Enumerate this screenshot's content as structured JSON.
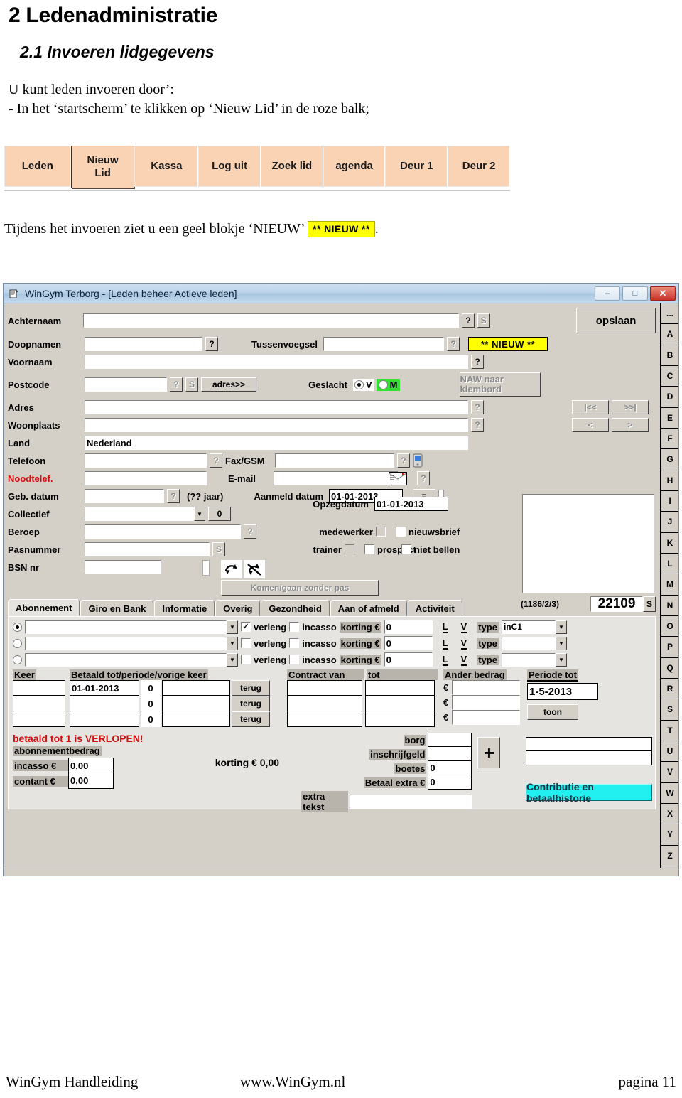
{
  "document": {
    "heading1": "2 Ledenadministratie",
    "heading2": "2.1 Invoeren lidgegevens",
    "para_line1": "U kunt leden invoeren door’:",
    "para_line2": "- In het ‘startscherm’ te klikken op ‘Nieuw Lid’ in de roze balk;",
    "caption_before": "Tijdens het invoeren ziet u een geel blokje ‘NIEUW’",
    "caption_badge": "** NIEUW **",
    "caption_after": "."
  },
  "pink_toolbar": {
    "buttons": [
      {
        "label": "Leden",
        "active": false
      },
      {
        "label": "Nieuw Lid",
        "active": true
      },
      {
        "label": "Kassa",
        "active": false
      },
      {
        "label": "Log uit",
        "active": false
      },
      {
        "label": "Zoek lid",
        "active": false
      },
      {
        "label": "agenda",
        "active": false
      },
      {
        "label": "Deur 1",
        "active": false
      },
      {
        "label": "Deur 2",
        "active": false
      }
    ],
    "accent_color": "#fad2b4"
  },
  "app_window": {
    "title": "WinGym Terborg - [Leden beheer Actieve leden]",
    "icon": "app-icon",
    "window_buttons": [
      {
        "name": "minimize",
        "glyph": "–"
      },
      {
        "name": "restore",
        "glyph": "□"
      },
      {
        "name": "close",
        "glyph": "✕"
      }
    ],
    "form": {
      "achternaam": {
        "label": "Achternaam",
        "value": ""
      },
      "doopnamen": {
        "label": "Doopnamen",
        "value": ""
      },
      "tussenvoegsel": {
        "label": "Tussenvoegsel",
        "value": ""
      },
      "voornaam": {
        "label": "Voornaam",
        "value": ""
      },
      "postcode": {
        "label": "Postcode",
        "value": ""
      },
      "adres_button": "adres>>",
      "geslacht": {
        "label": "Geslacht",
        "option_v": "V",
        "option_m": "M",
        "selected": "V"
      },
      "adres": {
        "label": "Adres",
        "value": ""
      },
      "woonplaats": {
        "label": "Woonplaats",
        "value": ""
      },
      "land": {
        "label": "Land",
        "value": "Nederland"
      },
      "telefoon": {
        "label": "Telefoon",
        "value": ""
      },
      "faxgsm": {
        "label": "Fax/GSM",
        "value": ""
      },
      "noodtelef": {
        "label": "Noodtelef.",
        "value": ""
      },
      "email": {
        "label": "E-mail",
        "value": ""
      },
      "geb_datum": {
        "label": "Geb. datum",
        "value": "",
        "age_hint": "(?? jaar)"
      },
      "collectief": {
        "label": "Collectief",
        "value": "",
        "side_button": "0"
      },
      "beroep": {
        "label": "Beroep",
        "value": ""
      },
      "pasnummer": {
        "label": "Pasnummer",
        "value": ""
      },
      "bsn_nr": {
        "label": "BSN nr",
        "value": ""
      },
      "aanmeld_datum": {
        "label": "Aanmeld datum",
        "value": "01-01-2013"
      },
      "opzegdatum": {
        "label": "Opzegdatum",
        "value": "01-01-2013"
      },
      "equals_button": "=",
      "medewerker": {
        "label": "medewerker",
        "checked": false
      },
      "trainer": {
        "label": "trainer",
        "checked": false
      },
      "nieuwsbrief": {
        "label": "nieuwsbrief",
        "checked": false
      },
      "prospect": {
        "label": "prospect",
        "checked": false
      },
      "niet_bellen": {
        "label": "niet bellen",
        "checked": false
      },
      "komen_gaan_button": "Komen/gaan zonder pas",
      "new_badge": "** NIEUW **",
      "opslaan_button": "opslaan",
      "naw_button": "NAW naar klembord",
      "nav_first": "|<<",
      "nav_last": ">>|",
      "nav_prev": "<",
      "nav_next": ">",
      "photo_counter": "(1186/2/3)",
      "member_number": "22109",
      "member_number_button": "S",
      "help_button": "?",
      "search_button": "S"
    },
    "tabs": [
      {
        "label": "Abonnement",
        "selected": true
      },
      {
        "label": "Giro en Bank",
        "selected": false
      },
      {
        "label": "Informatie",
        "selected": false
      },
      {
        "label": "Overig",
        "selected": false
      },
      {
        "label": "Gezondheid",
        "selected": false
      },
      {
        "label": "Aan of afmeld",
        "selected": false
      },
      {
        "label": "Activiteit",
        "selected": false
      }
    ],
    "abonnement": {
      "subscription_rows": [
        {
          "selected": true,
          "plan": "",
          "verleng_label": "verleng",
          "verleng": true,
          "incasso_label": "incasso",
          "incasso": false,
          "korting_label": "korting €",
          "korting": "0",
          "l_button": "L",
          "v_button": "V",
          "type_label": "type",
          "type_value": "inC1"
        },
        {
          "selected": false,
          "plan": "",
          "verleng_label": "verleng",
          "verleng": false,
          "incasso_label": "incasso",
          "incasso": false,
          "korting_label": "korting €",
          "korting": "0",
          "l_button": "L",
          "v_button": "V",
          "type_label": "type",
          "type_value": ""
        },
        {
          "selected": false,
          "plan": "",
          "verleng_label": "verleng",
          "verleng": false,
          "incasso_label": "incasso",
          "incasso": false,
          "korting_label": "korting €",
          "korting": "0",
          "l_button": "L",
          "v_button": "V",
          "type_label": "type",
          "type_value": ""
        }
      ],
      "keer_header": "Keer",
      "keer_values": [
        "",
        "",
        ""
      ],
      "betaald_header": "Betaald tot/periode/vorige keer",
      "betaald_tot": [
        "01-01-2013",
        "",
        ""
      ],
      "periode": [
        "0",
        "0",
        "0"
      ],
      "vorige_keer": [
        "",
        "",
        ""
      ],
      "terug_button": "terug",
      "contract_van_header": "Contract van",
      "tot_header": "tot",
      "contract_van": [
        "",
        "",
        ""
      ],
      "contract_tot": [
        "",
        "",
        ""
      ],
      "ander_bedrag_header": "Ander bedrag",
      "euro_symbol": "€",
      "ander_bedrag": [
        "",
        "",
        ""
      ],
      "periode_tot_label": "Periode tot",
      "periode_tot_value": "1-5-2013",
      "toon_button": "toon",
      "warning": "betaald tot 1 is VERLOPEN!",
      "abonnementbedrag_label": "abonnementbedrag",
      "incasso_label": "incasso €",
      "incasso_value": "0,00",
      "contant_label": "contant €",
      "contant_value": "0,00",
      "korting_total": "korting € 0,00",
      "borg_label": "borg",
      "borg_value": "",
      "inschrijfgeld_label": "inschrijfgeld",
      "inschrijfgeld_value": "",
      "boetes_label": "boetes",
      "boetes_value": "0",
      "betaal_extra_label": "Betaal extra €",
      "betaal_extra_value": "0",
      "extra_tekst_label": "extra tekst",
      "extra_tekst_value": "",
      "plus_button": "+",
      "contributie_button": "Contributie en betaalhistorie"
    },
    "alpha_index": [
      "...",
      "A",
      "B",
      "C",
      "D",
      "E",
      "F",
      "G",
      "H",
      "I",
      "J",
      "K",
      "L",
      "M",
      "N",
      "O",
      "P",
      "Q",
      "R",
      "S",
      "T",
      "U",
      "V",
      "W",
      "X",
      "Y",
      "Z"
    ]
  },
  "footer": {
    "left": "WinGym Handleiding",
    "center": "www.WinGym.nl",
    "right": "pagina 11"
  }
}
